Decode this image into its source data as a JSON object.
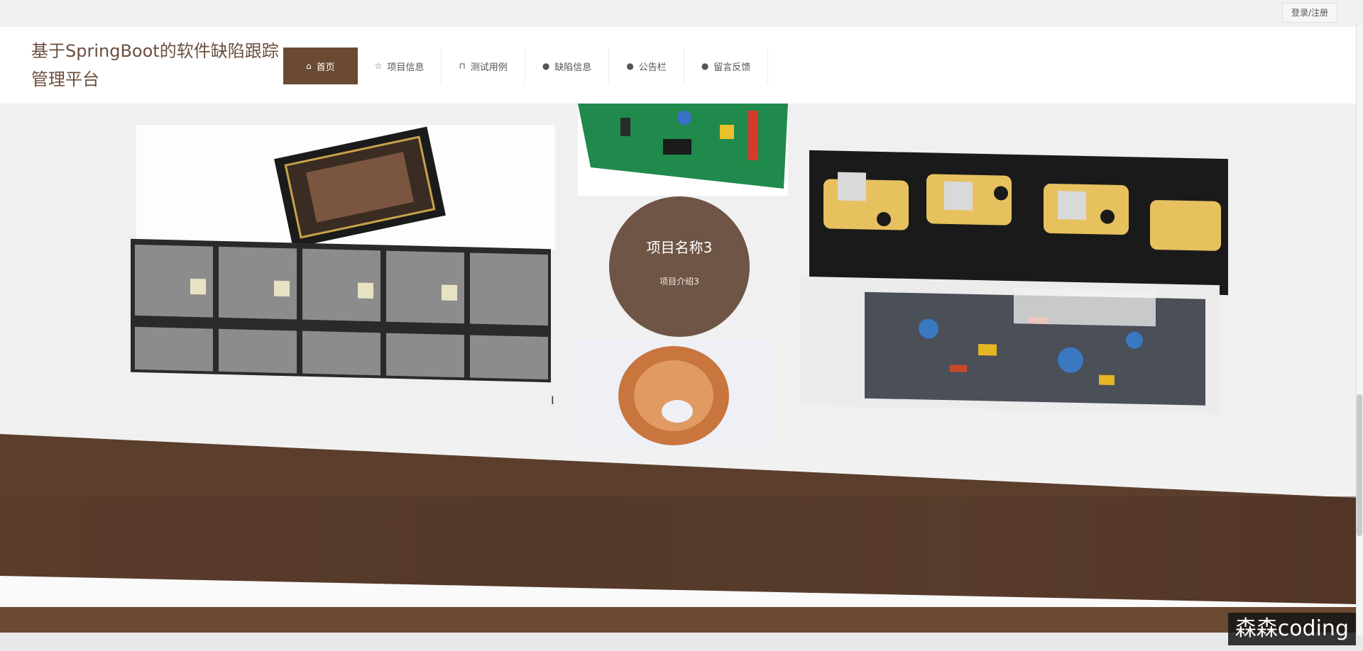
{
  "top_bar": {
    "login_label": "登录/注册"
  },
  "header": {
    "site_title": "基于SpringBoot的软件缺陷跟踪管理平台",
    "nav": [
      {
        "icon": "home-icon",
        "glyph": "⌂",
        "label": "首页",
        "active": true
      },
      {
        "icon": "star-icon",
        "glyph": "☆",
        "label": "项目信息"
      },
      {
        "icon": "bag-icon",
        "glyph": "⊓",
        "label": "测试用例"
      },
      {
        "icon": "alert-icon",
        "glyph": "●",
        "label": "缺陷信息"
      },
      {
        "icon": "question-icon",
        "glyph": "●",
        "label": "公告栏"
      },
      {
        "icon": "info-icon",
        "glyph": "●",
        "label": "留言反馈"
      }
    ]
  },
  "showcase": {
    "featured_title": "项目名称3",
    "featured_subtitle": "项目介绍3",
    "tiles": [
      {
        "name": "cpu-chip-image"
      },
      {
        "name": "circuit-board-image"
      },
      {
        "name": "ic-chips-row-image"
      },
      {
        "name": "power-transistors-image"
      },
      {
        "name": "toroid-coil-image"
      },
      {
        "name": "mixed-components-image"
      }
    ]
  },
  "watermark": "森森coding",
  "colors": {
    "brand_brown": "#6b4a33",
    "circle_brown": "#6f5546",
    "title_brown": "#6b4f3e"
  }
}
